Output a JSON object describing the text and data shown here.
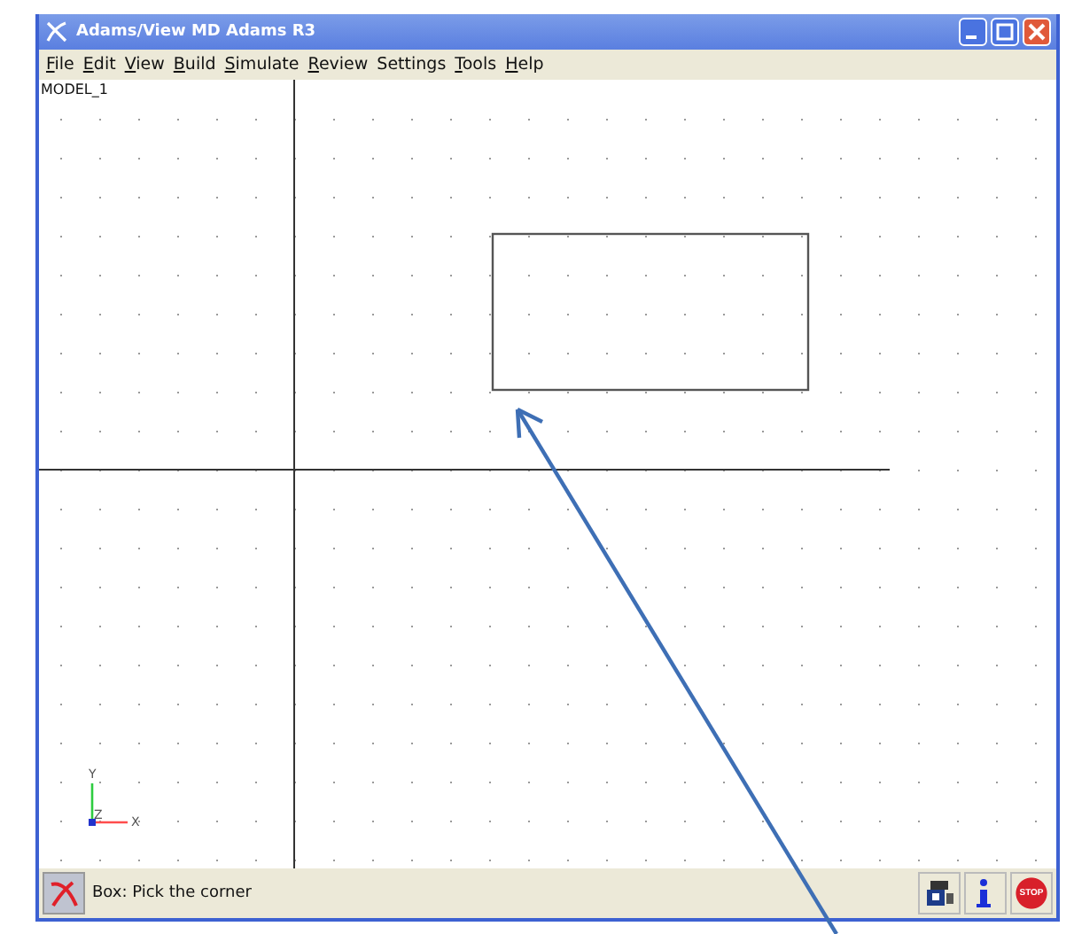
{
  "window": {
    "title": "Adams/View MD Adams R3"
  },
  "menu": [
    {
      "label": "File",
      "underlined": true
    },
    {
      "label": "Edit",
      "underlined": true
    },
    {
      "label": "View",
      "underlined": true
    },
    {
      "label": "Build",
      "underlined": true
    },
    {
      "label": "Simulate",
      "underlined": true
    },
    {
      "label": "Review",
      "underlined": true
    },
    {
      "label": "Settings",
      "underlined": false
    },
    {
      "label": "Tools",
      "underlined": true
    },
    {
      "label": "Help",
      "underlined": true
    }
  ],
  "canvas": {
    "model_name": "MODEL_1",
    "triad": {
      "y": "Y",
      "z": "Z",
      "x": "X"
    }
  },
  "status_bar": {
    "message": "Box: Pick the corner",
    "stop_label": "STOP"
  }
}
